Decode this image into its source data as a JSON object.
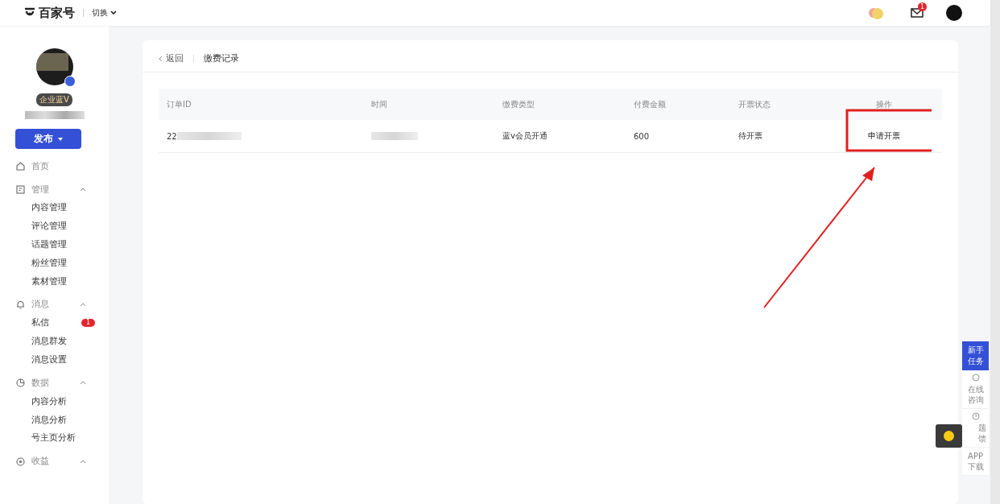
{
  "header": {
    "logo": "百家号",
    "switch": "切换",
    "mail_badge": "1"
  },
  "profile": {
    "badge": "企业蓝V",
    "verified": true
  },
  "publish_button": "发布",
  "nav": [
    {
      "label": "首页"
    },
    {
      "label": "管理",
      "expanded": true,
      "children": [
        {
          "label": "内容管理"
        },
        {
          "label": "评论管理"
        },
        {
          "label": "话题管理"
        },
        {
          "label": "粉丝管理"
        },
        {
          "label": "素材管理"
        }
      ]
    },
    {
      "label": "消息",
      "expanded": true,
      "children": [
        {
          "label": "私信",
          "badge": "1"
        },
        {
          "label": "消息群发"
        },
        {
          "label": "消息设置"
        }
      ]
    },
    {
      "label": "数据",
      "expanded": true,
      "children": [
        {
          "label": "内容分析"
        },
        {
          "label": "消息分析"
        },
        {
          "label": "号主页分析"
        }
      ]
    },
    {
      "label": "收益",
      "expanded": true
    }
  ],
  "breadcrumb": {
    "back": "返回",
    "title": "缴费记录"
  },
  "table": {
    "columns": [
      "订单ID",
      "时间",
      "缴费类型",
      "付费金额",
      "开票状态",
      "操作"
    ],
    "rows": [
      {
        "order_id": "22",
        "type": "蓝v会员开通",
        "amount": "600",
        "status": "待开票",
        "action": "申请开票"
      }
    ]
  },
  "float_panel": [
    {
      "kind": "primary",
      "label": "新手任务"
    },
    {
      "kind": "chat",
      "label": "在线咨询"
    },
    {
      "kind": "help",
      "label": "题馈"
    },
    {
      "kind": "app",
      "label": "APP下载"
    }
  ]
}
